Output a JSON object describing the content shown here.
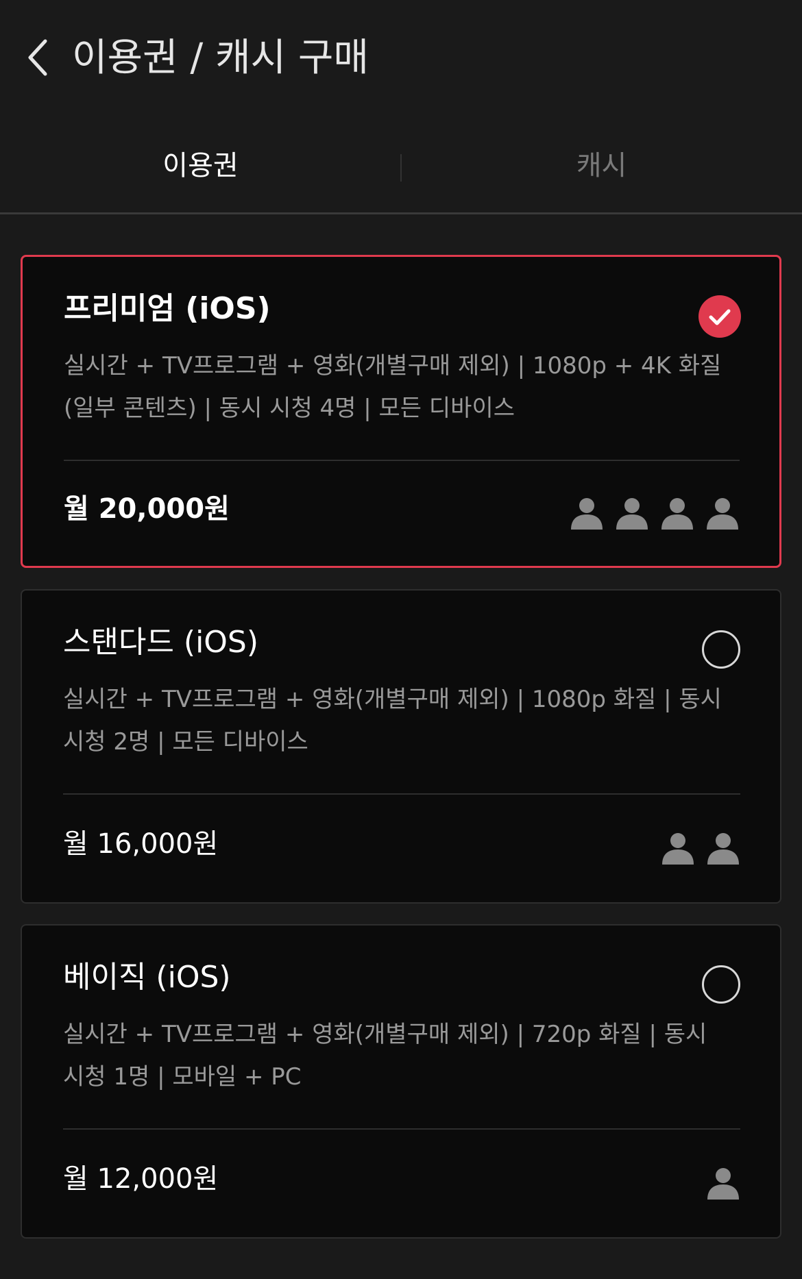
{
  "header": {
    "title": "이용권 / 캐시 구매"
  },
  "tabs": [
    {
      "label": "이용권",
      "active": true
    },
    {
      "label": "캐시",
      "active": false
    }
  ],
  "plans": [
    {
      "name": "프리미엄 (iOS)",
      "description": "실시간 + TV프로그램 + 영화(개별구매 제외)  |  1080p + 4K 화질(일부 콘텐츠)  |  동시 시청 4명  |  모든 디바이스",
      "price": "월 20,000원",
      "users": 4,
      "selected": true
    },
    {
      "name": "스탠다드 (iOS)",
      "description": "실시간 + TV프로그램 + 영화(개별구매 제외)  |  1080p 화질  |  동시 시청 2명  |  모든 디바이스",
      "price": "월 16,000원",
      "users": 2,
      "selected": false
    },
    {
      "name": "베이직 (iOS)",
      "description": "실시간 + TV프로그램 + 영화(개별구매 제외)  |  720p 화질  |  동시 시청 1명  |  모바일 + PC",
      "price": "월 12,000원",
      "users": 1,
      "selected": false
    }
  ],
  "colors": {
    "background": "#1a1a1a",
    "card": "#0b0b0b",
    "accent": "#e03a4e",
    "muted_text": "#9a9a9a",
    "user_icon": "#8a8a8a"
  },
  "icons": {
    "back": "chevron-left-icon",
    "selected": "check-circle-icon",
    "unselected": "radio-empty-icon",
    "user": "person-icon"
  }
}
